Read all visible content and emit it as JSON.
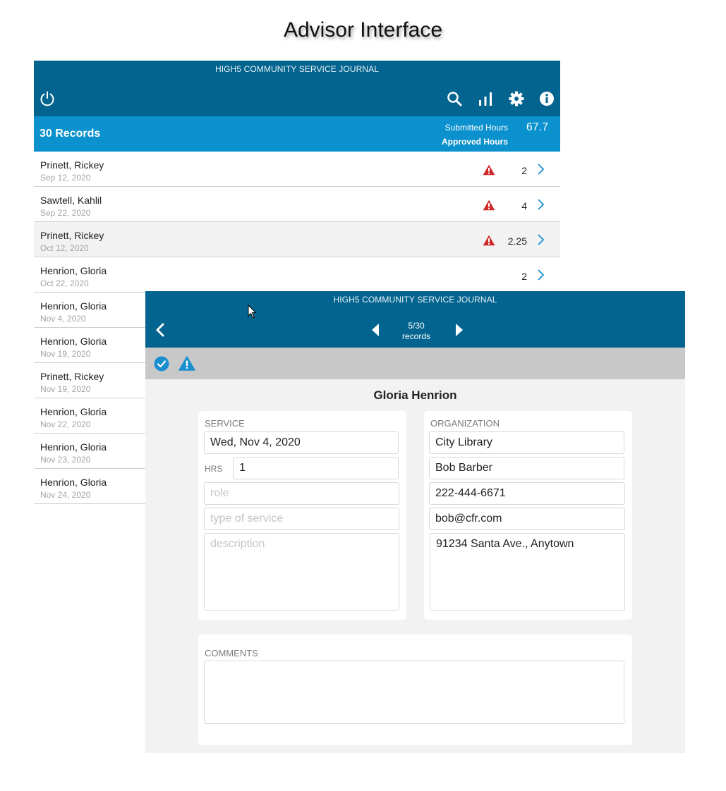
{
  "page": {
    "title": "Advisor Interface"
  },
  "app": {
    "name": "HIGH5 COMMUNITY SERVICE JOURNAL"
  },
  "list_view": {
    "header_icons": [
      "power-icon",
      "search-icon",
      "bar-chart-icon",
      "gear-icon",
      "info-icon"
    ],
    "summary": {
      "records_label": "30 Records",
      "submitted_label": "Submitted Hours",
      "submitted_value": "67.7",
      "approved_label": "Approved Hours"
    },
    "records": [
      {
        "name": "Prinett, Rickey",
        "date": "Sep 12, 2020",
        "warning": true,
        "hours": "2"
      },
      {
        "name": "Sawtell, Kahlil",
        "date": "Sep 22, 2020",
        "warning": true,
        "hours": "4"
      },
      {
        "name": "Prinett, Rickey",
        "date": "Oct 12, 2020",
        "warning": true,
        "hours": "2.25"
      },
      {
        "name": "Henrion, Gloria",
        "date": "Oct 22, 2020",
        "warning": false,
        "hours": "2"
      },
      {
        "name": "Henrion, Gloria",
        "date": "Nov 4, 2020",
        "warning": false,
        "hours": ""
      },
      {
        "name": "Henrion, Gloria",
        "date": "Nov 19, 2020",
        "warning": false,
        "hours": ""
      },
      {
        "name": "Prinett, Rickey",
        "date": "Nov 19, 2020",
        "warning": false,
        "hours": ""
      },
      {
        "name": "Henrion, Gloria",
        "date": "Nov 22, 2020",
        "warning": false,
        "hours": ""
      },
      {
        "name": "Henrion, Gloria",
        "date": "Nov 23, 2020",
        "warning": false,
        "hours": ""
      },
      {
        "name": "Henrion, Gloria",
        "date": "Nov 24, 2020",
        "warning": false,
        "hours": ""
      }
    ]
  },
  "detail_view": {
    "pager": {
      "position": "5/30",
      "unit": "records"
    },
    "student_name": "Gloria Henrion",
    "service": {
      "label": "SERVICE",
      "date_value": "Wed, Nov 4, 2020",
      "hrs_label": "HRS",
      "hrs_value": "1",
      "role_placeholder": "role",
      "type_placeholder": "type of service",
      "description_placeholder": "description"
    },
    "organization": {
      "label": "ORGANIZATION",
      "name": "City Library",
      "contact": "Bob Barber",
      "phone": "222-444-6671",
      "email": "bob@cfr.com",
      "address": "91234 Santa Ave., Anytown"
    },
    "comments": {
      "label": "COMMENTS",
      "value": ""
    }
  },
  "colors": {
    "header": "#03648f",
    "summary_bar": "#0a91ce",
    "warning": "#d0292a",
    "approve": "#1a8fd0"
  }
}
